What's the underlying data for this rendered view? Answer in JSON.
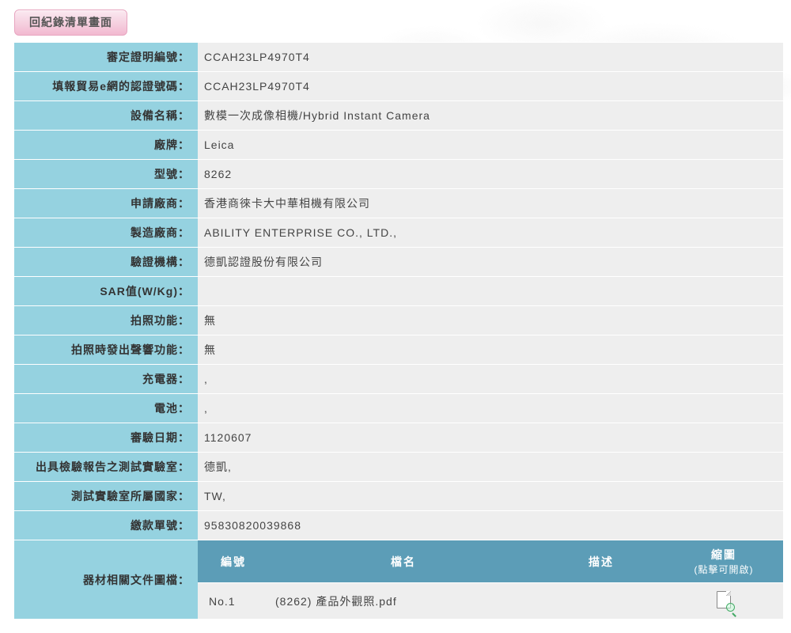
{
  "back_button_label": "回紀錄清單畫面",
  "rows": [
    {
      "label": "審定證明編號：",
      "value": "CCAH23LP4970T4"
    },
    {
      "label": "填報貿易e網的認證號碼：",
      "value": "CCAH23LP4970T4"
    },
    {
      "label": "設備名稱：",
      "value": "數模一次成像相機/Hybrid Instant Camera"
    },
    {
      "label": "廠牌：",
      "value": "Leica"
    },
    {
      "label": "型號：",
      "value": "8262"
    },
    {
      "label": "申請廠商：",
      "value": "香港商徠卡大中華相機有限公司"
    },
    {
      "label": "製造廠商：",
      "value": "ABILITY ENTERPRISE CO., LTD.,"
    },
    {
      "label": "驗證機構：",
      "value": "德凱認證股份有限公司"
    },
    {
      "label": "SAR值(W/Kg)：",
      "value": ""
    },
    {
      "label": "拍照功能：",
      "value": "無"
    },
    {
      "label": "拍照時發出聲響功能：",
      "value": "無"
    },
    {
      "label": "充電器：",
      "value": ","
    },
    {
      "label": "電池：",
      "value": ","
    },
    {
      "label": "審驗日期：",
      "value": "1120607"
    },
    {
      "label": "出具檢驗報告之測試實驗室：",
      "value": "德凱,"
    },
    {
      "label": "測試實驗室所屬國家：",
      "value": "TW,"
    },
    {
      "label": "繳款單號：",
      "value": "95830820039868"
    }
  ],
  "files_section": {
    "label": "器材相關文件圖檔：",
    "headers": {
      "number": "編號",
      "filename": "檔名",
      "description": "描述",
      "thumbnail": "縮圖",
      "thumbnail_sub": "(點擊可開啟)"
    },
    "items": [
      {
        "number": "No.1",
        "filename": "(8262) 產品外觀照.pdf",
        "description": ""
      }
    ]
  }
}
